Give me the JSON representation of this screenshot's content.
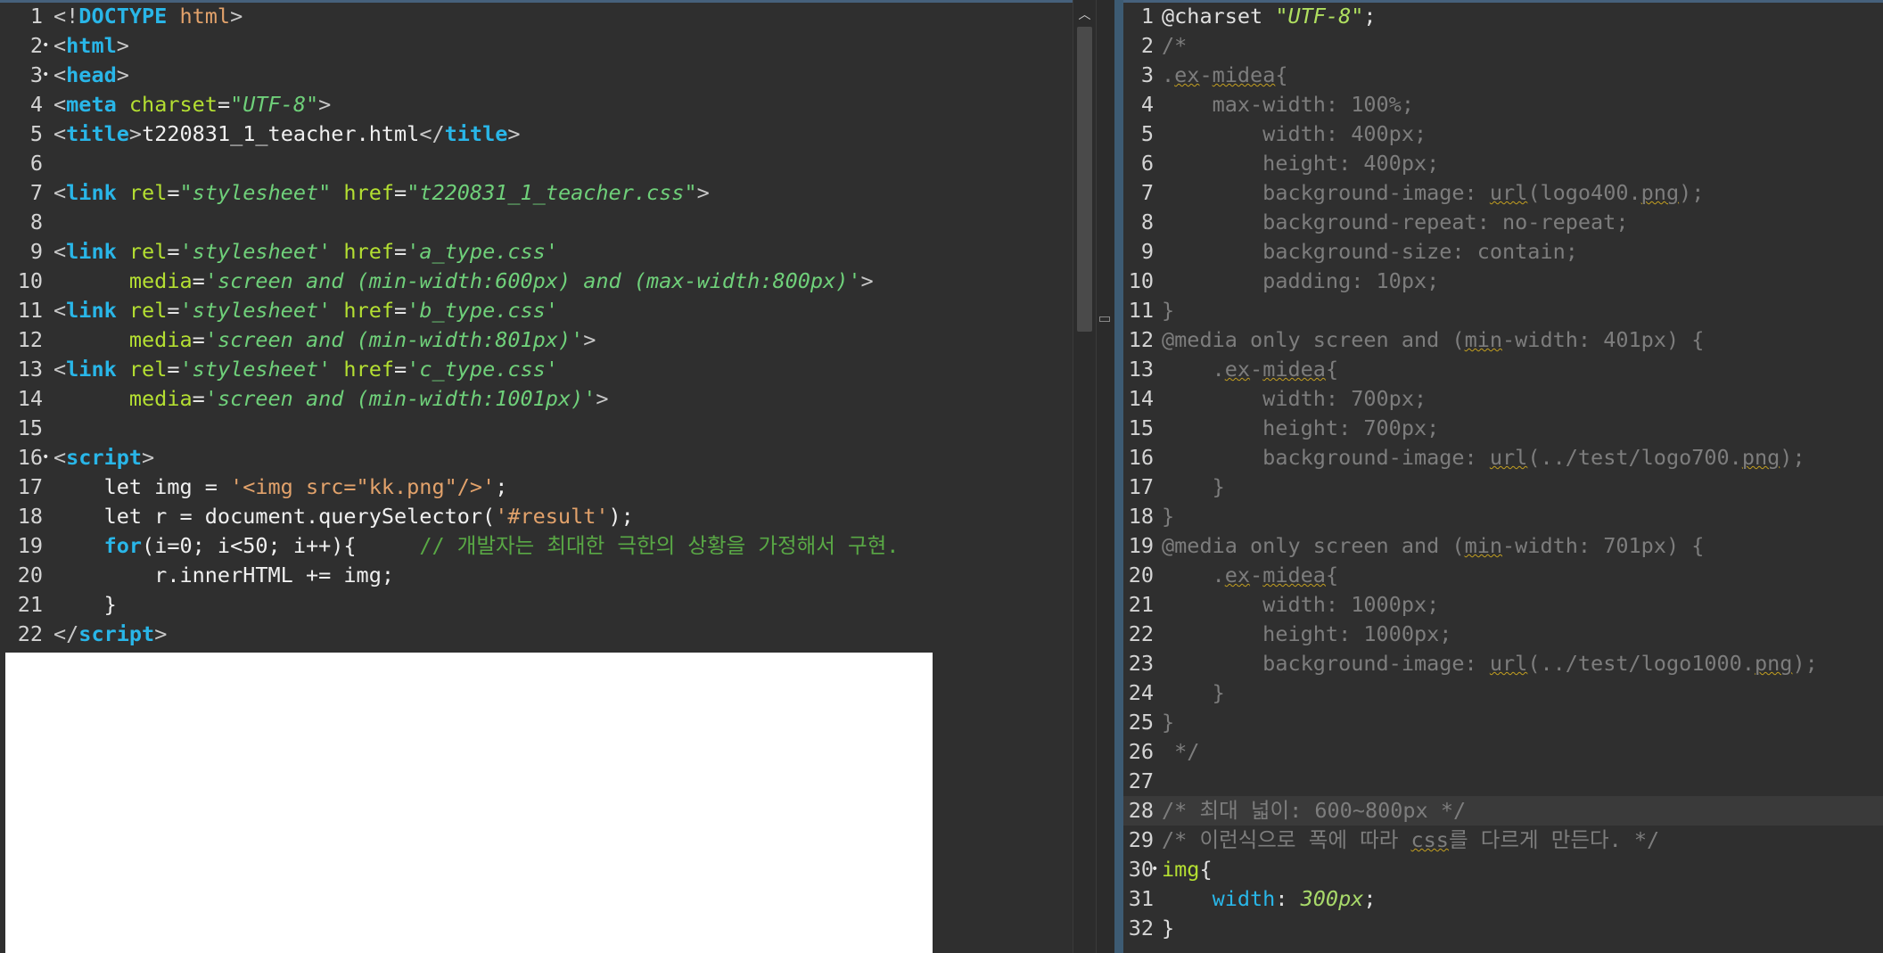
{
  "left_editor": {
    "lines": [
      {
        "n": "1",
        "fold": ""
      },
      {
        "n": "2",
        "fold": "•"
      },
      {
        "n": "3",
        "fold": "•"
      },
      {
        "n": "4",
        "fold": ""
      },
      {
        "n": "5",
        "fold": ""
      },
      {
        "n": "6",
        "fold": ""
      },
      {
        "n": "7",
        "fold": ""
      },
      {
        "n": "8",
        "fold": ""
      },
      {
        "n": "9",
        "fold": ""
      },
      {
        "n": "10",
        "fold": ""
      },
      {
        "n": "11",
        "fold": ""
      },
      {
        "n": "12",
        "fold": ""
      },
      {
        "n": "13",
        "fold": ""
      },
      {
        "n": "14",
        "fold": ""
      },
      {
        "n": "15",
        "fold": ""
      },
      {
        "n": "16",
        "fold": "•"
      },
      {
        "n": "17",
        "fold": ""
      },
      {
        "n": "18",
        "fold": ""
      },
      {
        "n": "19",
        "fold": ""
      },
      {
        "n": "20",
        "fold": ""
      },
      {
        "n": "21",
        "fold": ""
      },
      {
        "n": "22",
        "fold": ""
      }
    ],
    "code": {
      "l1_a": "<!",
      "l1_b": "DOCTYPE",
      "l1_c": " html",
      "l1_d": ">",
      "l2_a": "<",
      "l2_b": "html",
      "l2_c": ">",
      "l3_a": "<",
      "l3_b": "head",
      "l3_c": ">",
      "l4_a": "<",
      "l4_b": "meta",
      "l4_c": " charset",
      "l4_d": "=",
      "l4_e": "\"UTF-8\"",
      "l4_f": ">",
      "l5_a": "<",
      "l5_b": "title",
      "l5_c": ">",
      "l5_d": "t220831_1_teacher.html",
      "l5_e": "</",
      "l5_f": "title",
      "l5_g": ">",
      "l7_a": "<",
      "l7_b": "link",
      "l7_c": " rel",
      "l7_d": "=",
      "l7_e": "\"stylesheet\"",
      "l7_f": " href",
      "l7_g": "=",
      "l7_h": "\"t220831_1_teacher.css\"",
      "l7_i": ">",
      "l9_a": "<",
      "l9_b": "link",
      "l9_c": " rel",
      "l9_d": "=",
      "l9_e": "'stylesheet'",
      "l9_f": " href",
      "l9_g": "=",
      "l9_h": "'a_type.css'",
      "l10_a": "      media",
      "l10_b": "=",
      "l10_c": "'screen and (min-width:600px) and (max-width:800px)'",
      "l10_d": ">",
      "l11_a": "<",
      "l11_b": "link",
      "l11_c": " rel",
      "l11_d": "=",
      "l11_e": "'stylesheet'",
      "l11_f": " href",
      "l11_g": "=",
      "l11_h": "'b_type.css'",
      "l12_a": "      media",
      "l12_b": "=",
      "l12_c": "'screen and (min-width:801px)'",
      "l12_d": ">",
      "l13_a": "<",
      "l13_b": "link",
      "l13_c": " rel",
      "l13_d": "=",
      "l13_e": "'stylesheet'",
      "l13_f": " href",
      "l13_g": "=",
      "l13_h": "'c_type.css'",
      "l14_a": "      media",
      "l14_b": "=",
      "l14_c": "'screen and (min-width:1001px)'",
      "l14_d": ">",
      "l16_a": "<",
      "l16_b": "script",
      "l16_c": ">",
      "l17_a": "    let img = ",
      "l17_b": "'<img src=\"kk.png\"/>'",
      "l17_c": ";",
      "l18_a": "    let r = document.querySelector(",
      "l18_b": "'#result'",
      "l18_c": ");",
      "l19_a": "    ",
      "l19_b": "for",
      "l19_c": "(i=0; i<50; i++){     ",
      "l19_d": "// 개발자는 최대한 극한의 상황을 가정해서 구현.",
      "l20_a": "        r.innerHTML += img;",
      "l21_a": "    }",
      "l22_a": "</",
      "l22_b": "script",
      "l22_c": ">"
    }
  },
  "right_editor": {
    "lines": [
      {
        "n": "1",
        "fold": ""
      },
      {
        "n": "2",
        "fold": ""
      },
      {
        "n": "3",
        "fold": ""
      },
      {
        "n": "4",
        "fold": ""
      },
      {
        "n": "5",
        "fold": ""
      },
      {
        "n": "6",
        "fold": ""
      },
      {
        "n": "7",
        "fold": ""
      },
      {
        "n": "8",
        "fold": ""
      },
      {
        "n": "9",
        "fold": ""
      },
      {
        "n": "10",
        "fold": ""
      },
      {
        "n": "11",
        "fold": ""
      },
      {
        "n": "12",
        "fold": ""
      },
      {
        "n": "13",
        "fold": ""
      },
      {
        "n": "14",
        "fold": ""
      },
      {
        "n": "15",
        "fold": ""
      },
      {
        "n": "16",
        "fold": ""
      },
      {
        "n": "17",
        "fold": ""
      },
      {
        "n": "18",
        "fold": ""
      },
      {
        "n": "19",
        "fold": ""
      },
      {
        "n": "20",
        "fold": ""
      },
      {
        "n": "21",
        "fold": ""
      },
      {
        "n": "22",
        "fold": ""
      },
      {
        "n": "23",
        "fold": ""
      },
      {
        "n": "24",
        "fold": ""
      },
      {
        "n": "25",
        "fold": ""
      },
      {
        "n": "26",
        "fold": ""
      },
      {
        "n": "27",
        "fold": ""
      },
      {
        "n": "28",
        "fold": ""
      },
      {
        "n": "29",
        "fold": ""
      },
      {
        "n": "30",
        "fold": "•"
      },
      {
        "n": "31",
        "fold": ""
      },
      {
        "n": "32",
        "fold": ""
      }
    ],
    "code": {
      "r1_a": "@charset ",
      "r1_b": "\"UTF-8\"",
      "r1_c": ";",
      "r2": "/*",
      "r3_a": ".",
      "r3_b": "ex",
      "r3_c": "-",
      "r3_d": "midea",
      "r3_e": "{",
      "r4": "    max-width: 100%;",
      "r5": "        width: 400px;",
      "r6": "        height: 400px;",
      "r7_a": "        background-image: ",
      "r7_b": "url",
      "r7_c": "(logo400.",
      "r7_d": "png",
      "r7_e": ");",
      "r8": "        background-repeat: no-repeat;",
      "r9": "        background-size: contain;",
      "r10": "        padding: 10px;",
      "r11": "}",
      "r12_a": "@media only screen and (",
      "r12_b": "min",
      "r12_c": "-width: 401px) {",
      "r13_a": "    .",
      "r13_b": "ex",
      "r13_c": "-",
      "r13_d": "midea",
      "r13_e": "{",
      "r14": "        width: 700px;",
      "r15": "        height: 700px;",
      "r16_a": "        background-image: ",
      "r16_b": "url",
      "r16_c": "(../test/logo700.",
      "r16_d": "png",
      "r16_e": ");",
      "r17": "    }",
      "r18": "}",
      "r19_a": "@media only screen and (",
      "r19_b": "min",
      "r19_c": "-width: 701px) {",
      "r20_a": "    .",
      "r20_b": "ex",
      "r20_c": "-",
      "r20_d": "midea",
      "r20_e": "{",
      "r21": "        width: 1000px;",
      "r22": "        height: 1000px;",
      "r23_a": "        background-image: ",
      "r23_b": "url",
      "r23_c": "(../test/logo1000.",
      "r23_d": "png",
      "r23_e": ");",
      "r24": "    }",
      "r25": "}",
      "r26": " */",
      "r28": "/* 최대 넓이: 600~800px */",
      "r29_a": "/* 이런식으로 폭에 따라 ",
      "r29_b": "css",
      "r29_c": "를 다르게 만든다. */",
      "r30_a": "img",
      "r30_b": "{",
      "r31_a": "    width",
      "r31_b": ": ",
      "r31_c": "300px",
      "r31_d": ";",
      "r32": "}"
    }
  },
  "colors": {
    "editor_bg": "#2f2f2f",
    "tag": "#29b6e8",
    "attribute": "#b4df32",
    "string": "#6fd07a",
    "comment": "#59a845",
    "commented_out": "#7d7d7d"
  }
}
